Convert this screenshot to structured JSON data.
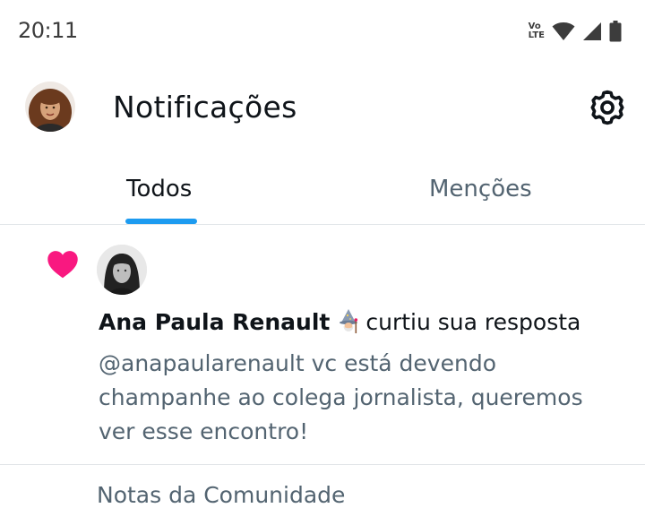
{
  "status_bar": {
    "time": "20:11",
    "volte_line1": "Vo",
    "volte_line2": "LTE",
    "icons": [
      "volte-icon",
      "wifi-icon",
      "signal-icon",
      "battery-icon"
    ]
  },
  "header": {
    "title": "Notificações",
    "settings_icon": "gear-icon"
  },
  "tabs": [
    {
      "label": "Todos",
      "selected": true
    },
    {
      "label": "Menções",
      "selected": false
    }
  ],
  "notifications": [
    {
      "type": "like",
      "icon": "heart-icon",
      "actor_name": "Ana Paula Renault",
      "actor_emoji": "wizard-emoji",
      "action": "curtiu sua resposta",
      "text": "@anapaularenault vc está devendo champanhe ao colega jornalista, queremos ver esse encontro!"
    }
  ],
  "next_item_partial": "Notas da Comunidade",
  "colors": {
    "accent": "#1d9bf0",
    "heart": "#f91880",
    "primary_text": "#0f1419",
    "secondary_text": "#536471",
    "divider": "#e1e5e8"
  }
}
